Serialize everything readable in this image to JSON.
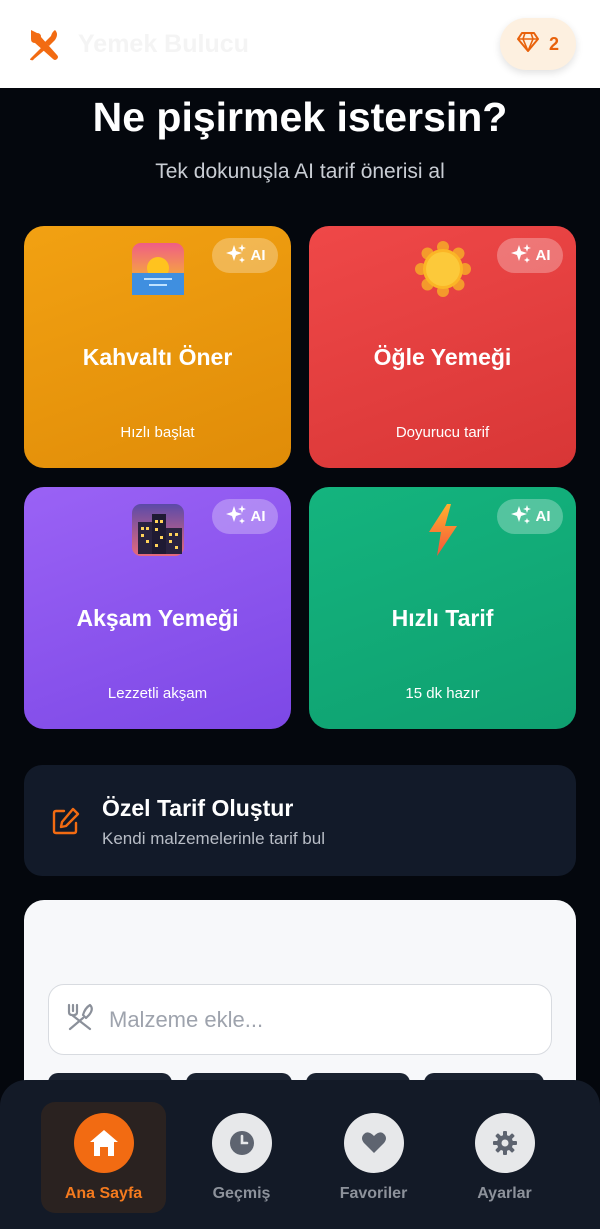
{
  "header": {
    "title": "Yemek Bulucu",
    "logo_icon": "fork-knife-icon",
    "gem_icon": "diamond-icon",
    "gem_count": "2"
  },
  "hero": {
    "title": "Ne pişirmek istersin?",
    "subtitle": "Tek dokunuşla AI tarif önerisi al"
  },
  "cards": [
    {
      "title": "Kahvaltı Öner",
      "subtitle": "Hızlı başlat",
      "badge": "AI",
      "icon": "sunrise-icon",
      "color": "#f2a112"
    },
    {
      "title": "Öğle Yemeği",
      "subtitle": "Doyurucu tarif",
      "badge": "AI",
      "icon": "sun-icon",
      "color": "#ef4848"
    },
    {
      "title": "Akşam Yemeği",
      "subtitle": "Lezzetli akşam",
      "badge": "AI",
      "icon": "city-dusk-icon",
      "color": "#9a62f5"
    },
    {
      "title": "Hızlı Tarif",
      "subtitle": "15 dk hazır",
      "badge": "AI",
      "icon": "lightning-icon",
      "color": "#14b47e"
    }
  ],
  "custom_recipe": {
    "title": "Özel Tarif Oluştur",
    "subtitle": "Kendi malzemelerinle tarif bul",
    "icon": "edit-icon"
  },
  "ingredient_search": {
    "placeholder": "Malzeme ekle...",
    "value": "",
    "icon": "utensils-icon"
  },
  "bottom_nav": [
    {
      "label": "Ana Sayfa",
      "icon": "home-icon",
      "active": true
    },
    {
      "label": "Geçmiş",
      "icon": "clock-icon",
      "active": false
    },
    {
      "label": "Favoriler",
      "icon": "heart-icon",
      "active": false
    },
    {
      "label": "Ayarlar",
      "icon": "gear-icon",
      "active": false
    }
  ],
  "colors": {
    "accent": "#f26b12",
    "background": "#04070d",
    "surface": "#121a29"
  }
}
